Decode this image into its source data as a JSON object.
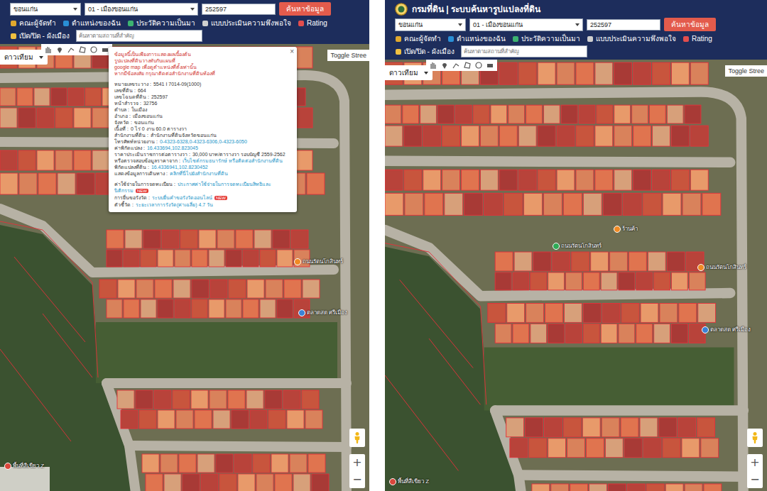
{
  "panels": [
    {
      "search": {
        "province": "ขอนแก่น",
        "district": "01 - เมืองขอนแก่น",
        "parcel": "252597",
        "button": "ค้นหาข้อมูล"
      },
      "menu": [
        "คณะผู้จัดทำ",
        "ตำแหน่งของฉัน",
        "ประวัติความเป็นมา",
        "แบบประเมินความพึงพอใจ",
        "Rating",
        "เปิด/ปิด - ผังเมือง"
      ],
      "landmark_search": {
        "placeholder": "ค้นหาตามสถานที่สำคัญ"
      },
      "map": {
        "type": "ดาวเทียม",
        "toggle": "Toggle Stree",
        "zoom_in": "+",
        "zoom_out": "−",
        "labels": [
          {
            "text": "ถนนรัตนโกสินทร์",
            "color": "#f08a24"
          },
          {
            "text": "ตลาดสด ศรีเมือง",
            "color": "#3b82d6"
          },
          {
            "text": "พื้นที่สีเขียว Z",
            "color": "#d9463b"
          }
        ],
        "popup": {
          "close": "×",
          "notice": [
            "ข้อมูลนี้เป็นเพียงการแสดงผลเบื้องต้น",
            "รูปแปลงที่ดินวางทับกับแผนที่",
            "google map เพื่อดูตำแหน่งที่ตั้งเท่านั้น",
            "หากมีข้อสงสัย กรุณาติดต่อสำนักงานที่ดินท้องที่"
          ],
          "fields": [
            {
              "label": "หมายเลขระวาง :",
              "value": "5541 I 7014-09(1000)",
              "link": false
            },
            {
              "label": "เลขที่ดิน :",
              "value": "664",
              "link": false
            },
            {
              "label": "เลขโฉนดที่ดิน :",
              "value": "252597",
              "link": false
            },
            {
              "label": "หน้าสำรวจ :",
              "value": "32756",
              "link": false
            },
            {
              "label": "ตำบล :",
              "value": "ในเมือง",
              "link": false
            },
            {
              "label": "อำเภอ :",
              "value": "เมืองขอนแก่น",
              "link": false
            },
            {
              "label": "จังหวัด :",
              "value": "ขอนแก่น",
              "link": false
            },
            {
              "label": "เนื้อที่ :",
              "value": "0 ไร่ 0 งาน 60.0 ตารางวา",
              "link": false
            },
            {
              "label": "สำนักงานที่ดิน :",
              "value": "สำนักงานที่ดินจังหวัดขอนแก่น",
              "link": false
            },
            {
              "label": "โทรศัพท์หน่วยงาน :",
              "value": "0-4323-6328,0-4323-6306,0-4323-6050",
              "link": true
            },
            {
              "label": "ค่าพิกัดแปลง :",
              "value": "16.433694,102.823045",
              "link": true
            },
            {
              "label": "ราคาประเมินราชการต่อตารางวา :",
              "value": "30,000 บาท/ตารางวา รอบบัญชี 2559-2562",
              "link": false
            },
            {
              "label": "หรือตรวจสอบข้อมูลราคาจาก :",
              "value": "เว็บไซต์กรมธนารักษ์ หรือติดต่อสำนักงานที่ดิน",
              "link": true
            },
            {
              "label": "พิกัดแปลงที่ดิน :",
              "value": "16.4336941,102.8230452",
              "link": true
            },
            {
              "label": "แสดงข้อมูลการเดินทาง :",
              "value": "คลิกที่นี่ไปยังสำนักงานที่ดิน",
              "link": true
            }
          ],
          "extras": [
            {
              "label": "ค่าใช้จ่ายในการจดทะเบียน :",
              "value": "ประกาศค่าใช้จ่ายในการจดทะเบียนสิทธิและนิติกรรม",
              "badge": "NEW"
            },
            {
              "label": "การยื่นขอรังวัด :",
              "value": "ระบบยื่นคำขอรังวัดออนไลน์",
              "badge": "NEW"
            },
            {
              "label": "ตัวชี้วัด :",
              "value": "ระยะเวลาการรังวัด(ค่าเฉลี่ย) 4.7 วัน",
              "badge": ""
            }
          ]
        }
      }
    },
    {
      "title": "กรมที่ดิน | ระบบค้นหารูปแปลงที่ดิน",
      "search": {
        "province": "ขอนแก่น",
        "district": "01 - เมืองขอนแก่น",
        "parcel": "252597",
        "button": "ค้นหาข้อมูล"
      },
      "menu": [
        "คณะผู้จัดทำ",
        "ตำแหน่งของฉัน",
        "ประวัติความเป็นมา",
        "แบบประเมินความพึงพอใจ",
        "Rating",
        "เปิด/ปิด - ผังเมือง"
      ],
      "landmark_search": {
        "placeholder": "ค้นหาตามสถานที่สำคัญ"
      },
      "map": {
        "type": "ดาวเทียม",
        "toggle": "Toggle Stree",
        "zoom_in": "+",
        "zoom_out": "−",
        "labels": [
          {
            "text": "ร้านค้า",
            "color": "#f08a24"
          },
          {
            "text": "ถนนรัตนโกสินทร์",
            "color": "#2eaa55"
          },
          {
            "text": "ถนนรัตนโกสินทร์",
            "color": "#f08a24"
          },
          {
            "text": "ตลาดสด ศรีเมือง",
            "color": "#3b82d6"
          },
          {
            "text": "พื้นที่สีเขียว Z",
            "color": "#d9463b"
          }
        ]
      }
    }
  ]
}
